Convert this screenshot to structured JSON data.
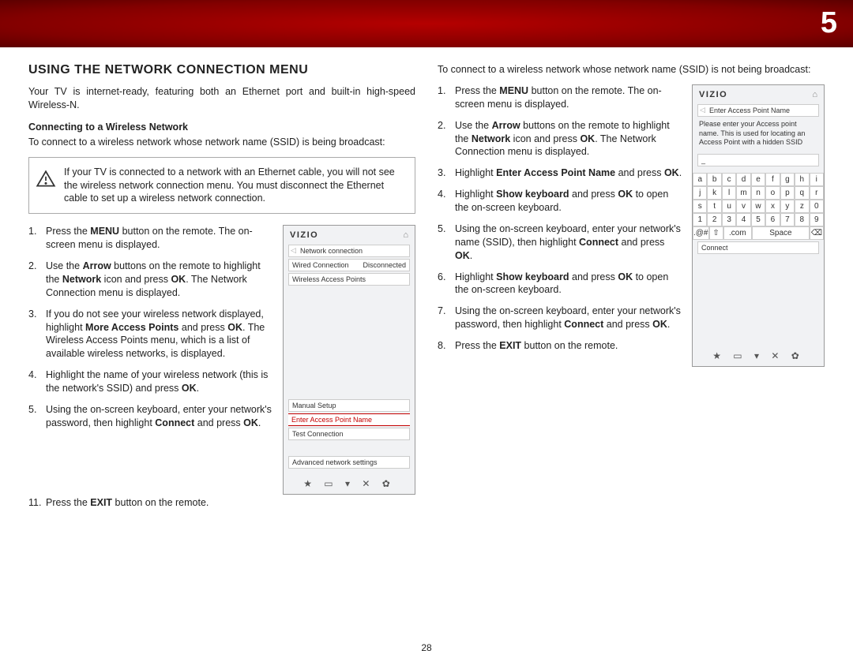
{
  "page": {
    "tab": "5",
    "number": "28"
  },
  "col1": {
    "h1": "USING THE NETWORK CONNECTION MENU",
    "intro": "Your TV is internet-ready, featuring both an Ethernet port and built-in high-speed Wireless-N.",
    "subh": "Connecting to a Wireless Network",
    "desc": "To connect to a wireless network whose network name (SSID) is being broadcast:",
    "warn": "If your TV is connected to a network with an Ethernet cable, you will not see the wireless network connection menu. You must disconnect the Ethernet cable to set up a wireless network connection.",
    "steps": [
      "Press the <b>MENU</b> button on the remote. The on-screen menu is displayed.",
      "Use the <b>Arrow</b> buttons on the remote to highlight the <b>Network</b> icon and press <b>OK</b>. The Network Connection menu is displayed.",
      "If you do not see your wireless network displayed, highlight <b>More Access Points</b> and press <b>OK</b>. The Wireless Access Points menu, which is a list of available wireless networks, is displayed.",
      "Highlight the name of your wireless network (this is the network's SSID) and press <b>OK</b>.",
      "Using the on-screen keyboard, enter your network's password, then highlight <b>Connect</b> and press <b>OK</b>.",
      "Press the <b>EXIT</b> button on the remote."
    ],
    "screen": {
      "brand": "VIZIO",
      "crumb": "Network connection",
      "row1a": "Wired Connection",
      "row1b": "Disconnected",
      "row2": "Wireless Access Points",
      "row3": "Manual Setup",
      "row4": "Enter Access Point Name",
      "row5": "Test Connection",
      "row6": "Advanced network settings",
      "icons": "★  ▭  ▾  ✕  ✿"
    }
  },
  "col2": {
    "desc": "To connect to a wireless network whose network name (SSID) is not being broadcast:",
    "steps": [
      "Press the <b>MENU</b> button on the remote. The on-screen menu is displayed.",
      "Use the <b>Arrow</b> buttons on the remote to highlight the <b>Network</b> icon and press <b>OK</b>. The Network Connection menu is displayed.",
      "Highlight <b>Enter Access Point Name</b> and press <b>OK</b>.",
      "Highlight <b>Show keyboard</b> and press <b>OK</b> to open the on-screen keyboard.",
      "Using the on-screen keyboard, enter your network's name (SSID), then highlight <b>Connect</b> and press <b>OK</b>.",
      "Highlight <b>Show keyboard</b> and press <b>OK</b> to open the on-screen keyboard.",
      "Using the on-screen keyboard, enter your network's password, then highlight <b>Connect</b> and press <b>OK</b>.",
      "Press the <b>EXIT</b> button on the remote."
    ],
    "screen": {
      "brand": "VIZIO",
      "crumb": "Enter Access Point Name",
      "note": "Please enter your Access point name. This is used for locating an Access Point with a hidden SSID",
      "keys_row1": [
        "a",
        "b",
        "c",
        "d",
        "e",
        "f",
        "g",
        "h",
        "i"
      ],
      "keys_row2": [
        "j",
        "k",
        "l",
        "m",
        "n",
        "o",
        "p",
        "q",
        "r"
      ],
      "keys_row3": [
        "s",
        "t",
        "u",
        "v",
        "w",
        "x",
        "y",
        "z",
        "0"
      ],
      "keys_row4": [
        "1",
        "2",
        "3",
        "4",
        "5",
        "6",
        "7",
        "8",
        "9"
      ],
      "sym": ".@#",
      "shift": "⇧",
      "com": ".com",
      "space": "Space",
      "del": "⌫",
      "connect": "Connect",
      "icons": "★  ▭  ▾  ✕  ✿"
    }
  }
}
